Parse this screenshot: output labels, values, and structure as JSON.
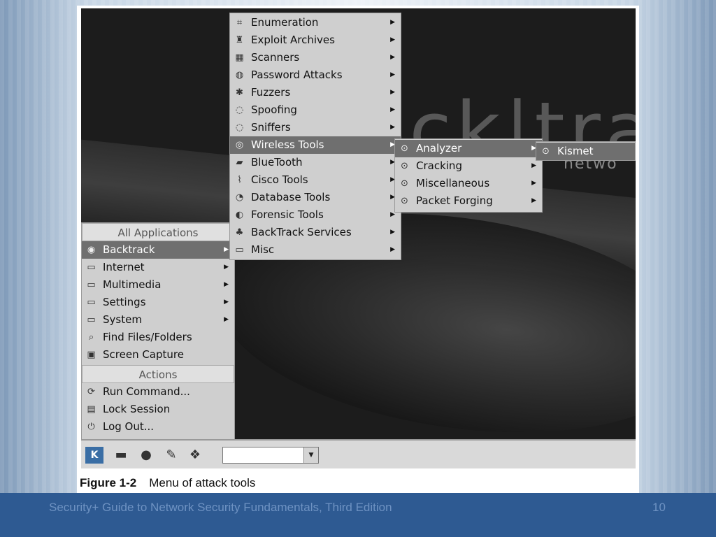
{
  "app_menu": {
    "header_all": "All Applications",
    "header_actions": "Actions",
    "items": [
      {
        "label": "Backtrack",
        "icon": "backtrack-icon",
        "active": true,
        "submenu": true
      },
      {
        "label": "Internet",
        "icon": "folder-icon",
        "submenu": true
      },
      {
        "label": "Multimedia",
        "icon": "folder-icon",
        "submenu": true
      },
      {
        "label": "Settings",
        "icon": "folder-icon",
        "submenu": true
      },
      {
        "label": "System",
        "icon": "folder-icon",
        "submenu": true
      },
      {
        "label": "Find Files/Folders",
        "icon": "search-icon",
        "submenu": false
      },
      {
        "label": "Screen Capture",
        "icon": "camera-icon",
        "submenu": false
      }
    ],
    "actions": [
      {
        "label": "Run Command...",
        "icon": "run-icon"
      },
      {
        "label": "Lock Session",
        "icon": "lock-icon"
      },
      {
        "label": "Log Out...",
        "icon": "logout-icon"
      }
    ]
  },
  "backtrack_menu": {
    "items": [
      {
        "label": "Enumeration",
        "icon": "enumeration-icon"
      },
      {
        "label": "Exploit Archives",
        "icon": "exploit-icon"
      },
      {
        "label": "Scanners",
        "icon": "scanner-icon"
      },
      {
        "label": "Password Attacks",
        "icon": "password-icon"
      },
      {
        "label": "Fuzzers",
        "icon": "fuzzer-icon"
      },
      {
        "label": "Spoofing",
        "icon": "spoofing-icon"
      },
      {
        "label": "Sniffers",
        "icon": "sniffer-icon"
      },
      {
        "label": "Wireless Tools",
        "icon": "wireless-icon",
        "active": true
      },
      {
        "label": "BlueTooth",
        "icon": "bluetooth-icon"
      },
      {
        "label": "Cisco Tools",
        "icon": "cisco-icon"
      },
      {
        "label": "Database Tools",
        "icon": "database-icon"
      },
      {
        "label": "Forensic Tools",
        "icon": "forensic-icon"
      },
      {
        "label": "BackTrack Services",
        "icon": "services-icon"
      },
      {
        "label": "Misc",
        "icon": "folder-icon"
      }
    ]
  },
  "wireless_menu": {
    "items": [
      {
        "label": "Analyzer",
        "icon": "antenna-icon",
        "active": true
      },
      {
        "label": "Cracking",
        "icon": "antenna-icon"
      },
      {
        "label": "Miscellaneous",
        "icon": "antenna-icon"
      },
      {
        "label": "Packet Forging",
        "icon": "antenna-icon"
      }
    ]
  },
  "analyzer_menu": {
    "items": [
      {
        "label": "Kismet",
        "icon": "antenna-icon",
        "active": true
      }
    ]
  },
  "wallpaper": {
    "brand": "back|tra",
    "sub": "netwo"
  },
  "taskbar": {
    "icons": [
      "kde-start-icon",
      "terminal-icon",
      "browser-icon",
      "network-icon",
      "package-icon"
    ]
  },
  "caption": {
    "label": "Figure 1-2",
    "text": "Menu of attack tools"
  },
  "footer": {
    "title": "Security+ Guide to Network Security Fundamentals, Third Edition",
    "page": "10"
  },
  "colors": {
    "footer_band": "#2e5a92",
    "footer_text": "#6e92c2",
    "menu_bg": "#cfcfcf",
    "menu_active": "#6f6f6f"
  }
}
